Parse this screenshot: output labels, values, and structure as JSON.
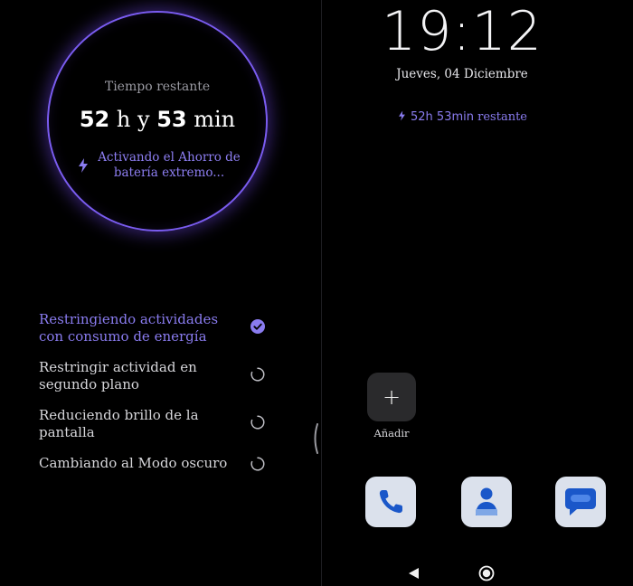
{
  "battery_screen": {
    "ring_label": "Tiempo restante",
    "time_hours": "52",
    "time_h_sep": "h y",
    "time_minutes": "53",
    "time_min_unit": "min",
    "status": "Activando el Ahorro de batería extremo...",
    "steps": [
      {
        "label": "Restringiendo actividades con consumo de energía",
        "state": "done"
      },
      {
        "label": "Restringir actividad en segundo plano",
        "state": "pending"
      },
      {
        "label": "Reduciendo brillo de la pantalla",
        "state": "pending"
      },
      {
        "label": "Cambiando al Modo oscuro",
        "state": "pending"
      }
    ]
  },
  "home_screen": {
    "clock": "19:12",
    "date": "Jueves, 04 Diciembre",
    "remaining_hours": "52h 53min",
    "remaining_word": "restante",
    "add_label": "Añadir",
    "add_symbol": "+",
    "dock": [
      "phone-icon",
      "contacts-icon",
      "messages-icon"
    ],
    "nav": [
      "back-icon",
      "home-icon"
    ]
  },
  "colors": {
    "accent": "#8a7cf0",
    "ring": "#7a5cf0",
    "background": "#000000",
    "dock_tile": "#dbe1ec",
    "app_blue": "#1a57c9"
  }
}
